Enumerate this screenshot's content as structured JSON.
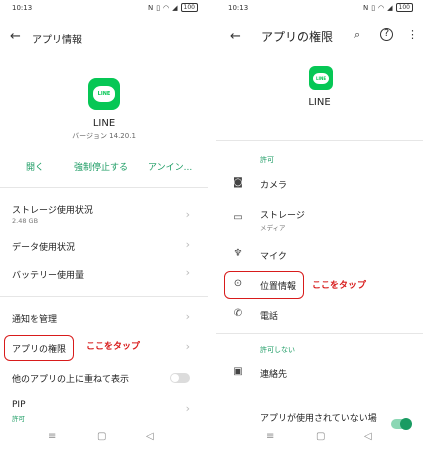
{
  "left": {
    "status": {
      "time": "10:13",
      "battery": "100"
    },
    "title": "アプリ情報",
    "app_name": "LINE",
    "version": "バージョン 14.20.1",
    "actions": [
      "開く",
      "強制停止する",
      "アンイン..."
    ],
    "rows": [
      {
        "label": "ストレージ使用状況",
        "sub": "2.48 GB"
      },
      {
        "label": "データ使用状況"
      },
      {
        "label": "バッテリー使用量"
      },
      {
        "label": "通知を管理"
      },
      {
        "label": "アプリの権限"
      },
      {
        "label": "他のアプリの上に重ねて表示"
      },
      {
        "label": "PIP",
        "sub": "許可"
      }
    ],
    "annotation": "ここをタップ"
  },
  "right": {
    "status": {
      "time": "10:13",
      "battery": "100"
    },
    "title": "アプリの権限",
    "app_name": "LINE",
    "allowed_header": "許可",
    "allowed": [
      {
        "label": "カメラ",
        "icon": "camera-icon"
      },
      {
        "label": "ストレージ",
        "sub": "メディア",
        "icon": "folder-icon"
      },
      {
        "label": "マイク",
        "icon": "microphone-icon"
      },
      {
        "label": "位置情報",
        "icon": "location-icon"
      },
      {
        "label": "電話",
        "icon": "phone-icon"
      }
    ],
    "denied_header": "許可しない",
    "denied": [
      {
        "label": "連絡先",
        "icon": "contacts-icon"
      }
    ],
    "unused_label": "アプリが使用されていない場",
    "annotation": "ここをタップ"
  },
  "colors": {
    "accent": "#1a9b62",
    "annotation": "#d81b1b",
    "line_green": "#06c755"
  }
}
